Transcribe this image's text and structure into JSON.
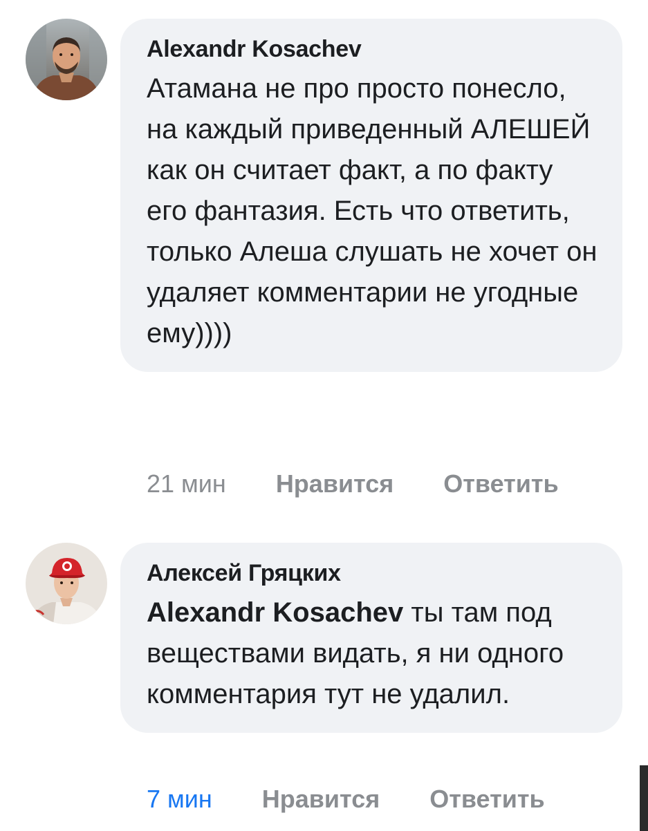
{
  "comments": [
    {
      "author": "Alexandr Kosachev",
      "avatar": "avatar-man-beard",
      "mention": "",
      "text": "Атамана не про просто понесло, на каждый приведенный АЛЕШЕЙ как он считает факт, а по факту его фантазия. Есть что ответить, только Алеша слушать не хочет он удаляет комментарии не угодные ему))))",
      "time": "21 мин",
      "like_label": "Нравится",
      "reply_label": "Ответить"
    },
    {
      "author": "Алексей Гряцких",
      "avatar": "avatar-man-red-cap",
      "mention": "Alexandr Kosachev",
      "text": " ты там под веществами видать, я ни одного комментария тут не удалил.",
      "time": "7 мин",
      "like_label": "Нравится",
      "reply_label": "Ответить"
    }
  ],
  "colors": {
    "bubble": "#f0f2f5",
    "meta": "#8a8d91",
    "new_time": "#1877f2"
  }
}
